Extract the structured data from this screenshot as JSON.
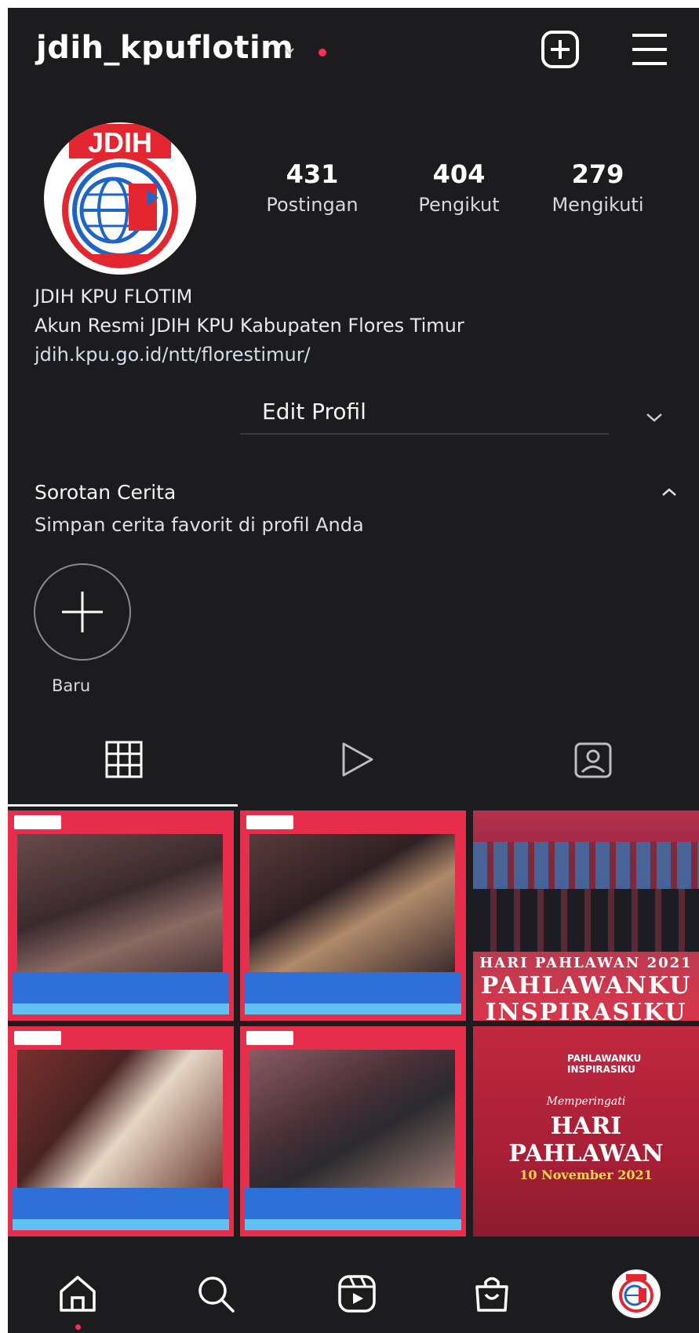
{
  "header": {
    "username": "jdih_kpuflotim"
  },
  "profile": {
    "stats": [
      {
        "value": "431",
        "label": "Postingan"
      },
      {
        "value": "404",
        "label": "Pengikut"
      },
      {
        "value": "279",
        "label": "Mengikuti"
      }
    ],
    "avatar_text": "JDIH",
    "name": "JDIH KPU FLOTIM",
    "bio": "Akun Resmi JDIH KPU Kabupaten Flores Timur",
    "link": "jdih.kpu.go.id/ntt/florestimur/",
    "edit_button": "Edit Profil"
  },
  "highlights": {
    "title": "Sorotan Cerita",
    "subtitle": "Simpan cerita favorit di profil Anda",
    "new_label": "Baru"
  },
  "posts": {
    "post3": {
      "line1": "HARI PAHLAWAN 2021",
      "line2": "PAHLAWANKU",
      "line3": "INSPIRASIKU"
    },
    "post6": {
      "small": "PAHLAWANKU INSPIRASIKU",
      "sub": "Memperingati",
      "title": "HARI PAHLAWAN",
      "date": "10 November 2021"
    }
  },
  "colors": {
    "background": "#1c1c1e",
    "accent_red": "#e62e4c",
    "notification": "#ff2d55"
  }
}
